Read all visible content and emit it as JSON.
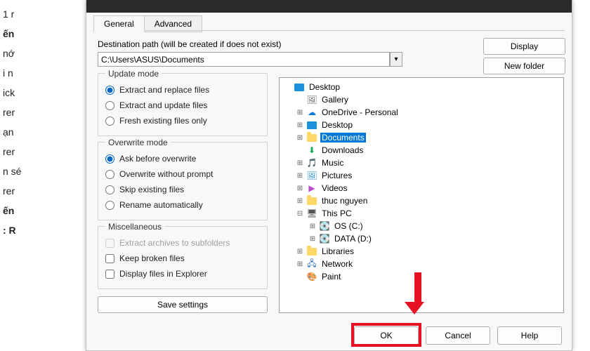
{
  "background_text": [
    "1 r",
    "",
    "ến",
    "nớ",
    "i n",
    "",
    "ick",
    "rer",
    "",
    "ạn",
    "",
    "rer",
    "",
    "n sé",
    "rer",
    "",
    "ến",
    "",
    ": R"
  ],
  "tabs": {
    "general": "General",
    "advanced": "Advanced"
  },
  "dest": {
    "label": "Destination path (will be created if does not exist)",
    "value": "C:\\Users\\ASUS\\Documents"
  },
  "buttons": {
    "display": "Display",
    "new_folder": "New folder",
    "save_settings": "Save settings",
    "ok": "OK",
    "cancel": "Cancel",
    "help": "Help"
  },
  "update_mode": {
    "title": "Update mode",
    "opt1": "Extract and replace files",
    "opt2": "Extract and update files",
    "opt3": "Fresh existing files only"
  },
  "overwrite_mode": {
    "title": "Overwrite mode",
    "opt1": "Ask before overwrite",
    "opt2": "Overwrite without prompt",
    "opt3": "Skip existing files",
    "opt4": "Rename automatically"
  },
  "misc": {
    "title": "Miscellaneous",
    "opt1": "Extract archives to subfolders",
    "opt2": "Keep broken files",
    "opt3": "Display files in Explorer"
  },
  "tree": {
    "desktop": "Desktop",
    "gallery": "Gallery",
    "onedrive": "OneDrive - Personal",
    "desktop2": "Desktop",
    "documents": "Documents",
    "downloads": "Downloads",
    "music": "Music",
    "pictures": "Pictures",
    "videos": "Videos",
    "user": "thuc nguyen",
    "thispc": "This PC",
    "osc": "OS (C:)",
    "datad": "DATA (D:)",
    "libraries": "Libraries",
    "network": "Network",
    "paint": "Paint"
  }
}
